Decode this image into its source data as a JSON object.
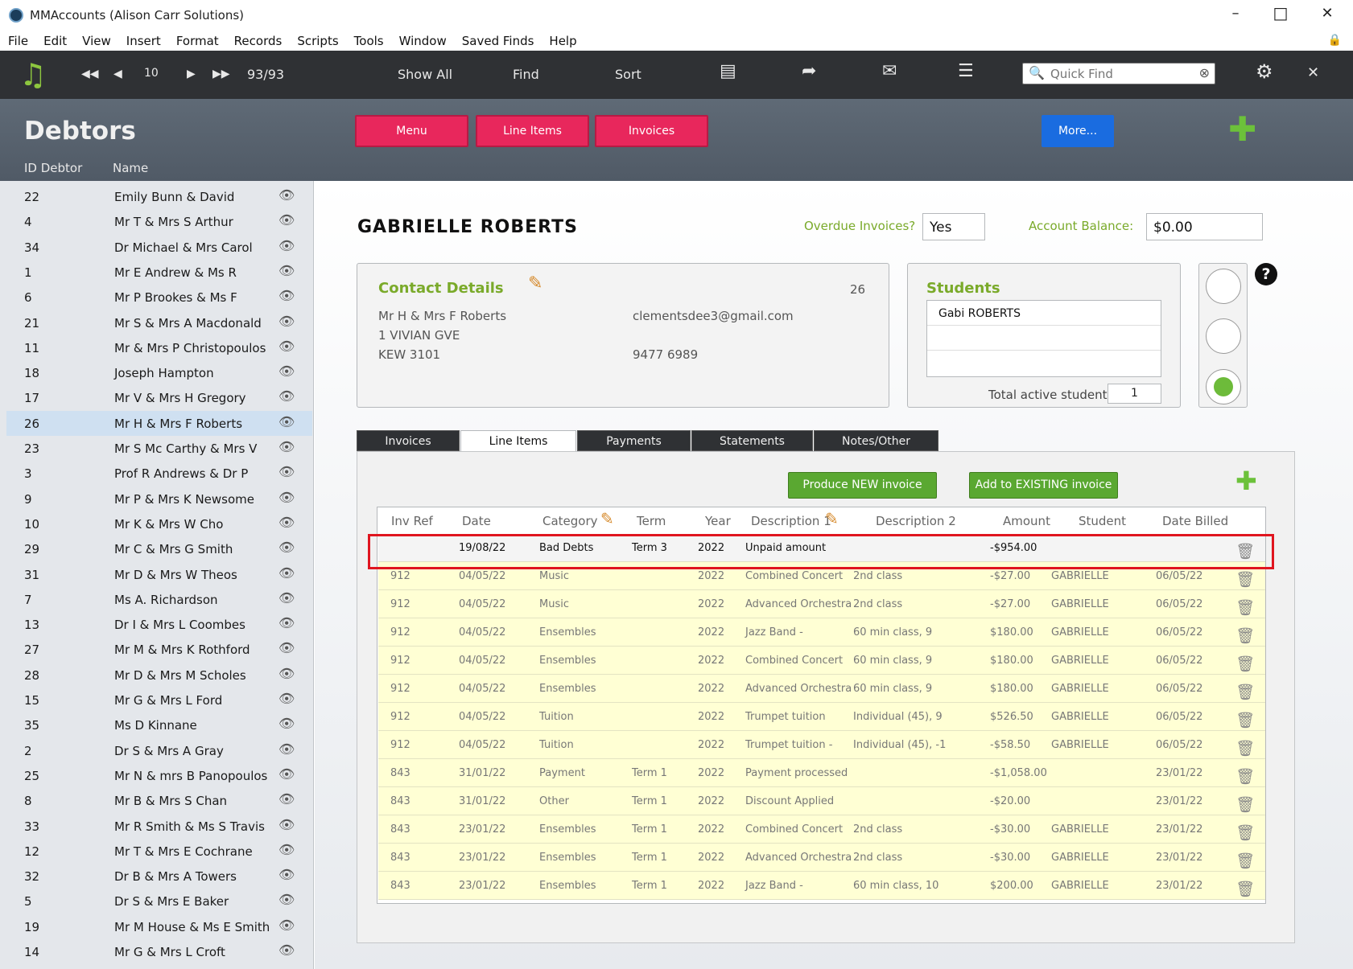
{
  "window": {
    "title": "MMAccounts (Alison Carr Solutions)"
  },
  "menu": [
    "File",
    "Edit",
    "View",
    "Insert",
    "Format",
    "Records",
    "Scripts",
    "Tools",
    "Window",
    "Saved Finds",
    "Help"
  ],
  "toolbar": {
    "record_num": "10",
    "record_count": "93/93",
    "show_all": "Show All",
    "find": "Find",
    "sort": "Sort",
    "quick_find_placeholder": "Quick Find"
  },
  "header": {
    "title": "Debtors",
    "col_id": "ID Debtor",
    "col_name": "Name",
    "menu_btn": "Menu",
    "line_items_btn": "Line Items",
    "invoices_btn": "Invoices",
    "more_btn": "More..."
  },
  "debtors": [
    {
      "id": "22",
      "name": "Emily Bunn & David"
    },
    {
      "id": "4",
      "name": "Mr T & Mrs S Arthur"
    },
    {
      "id": "34",
      "name": "Dr Michael & Mrs Carol"
    },
    {
      "id": "1",
      "name": "Mr E Andrew & Ms R"
    },
    {
      "id": "6",
      "name": "Mr P Brookes & Ms F"
    },
    {
      "id": "21",
      "name": "Mr S & Mrs A Macdonald"
    },
    {
      "id": "11",
      "name": "Mr & Mrs P Christopoulos"
    },
    {
      "id": "18",
      "name": "Joseph Hampton"
    },
    {
      "id": "17",
      "name": "Mr V & Mrs H Gregory"
    },
    {
      "id": "26",
      "name": "Mr H & Mrs F Roberts"
    },
    {
      "id": "23",
      "name": "Mr S Mc Carthy & Mrs V"
    },
    {
      "id": "3",
      "name": "Prof R Andrews & Dr P"
    },
    {
      "id": "9",
      "name": "Mr P & Mrs K Newsome"
    },
    {
      "id": "10",
      "name": "Mr K & Mrs W Cho"
    },
    {
      "id": "29",
      "name": "Mr C & Mrs G Smith"
    },
    {
      "id": "31",
      "name": "Mr D & Mrs W Theos"
    },
    {
      "id": "7",
      "name": "Ms A. Richardson"
    },
    {
      "id": "13",
      "name": "Dr I & Mrs L Coombes"
    },
    {
      "id": "27",
      "name": "Mr M & Mrs K Rothford"
    },
    {
      "id": "28",
      "name": "Mr D & Mrs M Scholes"
    },
    {
      "id": "15",
      "name": "Mr G & Mrs L Ford"
    },
    {
      "id": "35",
      "name": "Ms D Kinnane"
    },
    {
      "id": "2",
      "name": "Dr S & Mrs A Gray"
    },
    {
      "id": "25",
      "name": "Mr N & mrs B Panopoulos"
    },
    {
      "id": "8",
      "name": "Mr B & Mrs S Chan"
    },
    {
      "id": "33",
      "name": "Mr R Smith & Ms S Travis"
    },
    {
      "id": "12",
      "name": "Mr T & Mrs E Cochrane"
    },
    {
      "id": "32",
      "name": "Dr B & Mrs A Towers"
    },
    {
      "id": "5",
      "name": "Dr S & Mrs E Baker"
    },
    {
      "id": "19",
      "name": "Mr M House & Ms E Smith"
    },
    {
      "id": "14",
      "name": "Mr G & Mrs L Croft"
    }
  ],
  "selected_debtor_id": "26",
  "record": {
    "name": "GABRIELLE ROBERTS",
    "overdue_label": "Overdue Invoices?",
    "overdue_value": "Yes",
    "balance_label": "Account Balance:",
    "balance_value": "$0.00",
    "contact_title": "Contact Details",
    "contact_id": "26",
    "contact_name": "Mr H & Mrs F Roberts",
    "address1": "1 VIVIAN GVE",
    "address2": "KEW  3101",
    "email": "clementsdee3@gmail.com",
    "phone": "9477 6989",
    "students_title": "Students",
    "students": [
      "Gabi ROBERTS",
      "",
      ""
    ],
    "total_active_label": "Total active students",
    "total_active_value": "1"
  },
  "tabs": [
    "Invoices",
    "Line Items",
    "Payments",
    "Statements",
    "Notes/Other"
  ],
  "active_tab": "Line Items",
  "buttons": {
    "produce_new": "Produce NEW invoice",
    "add_existing": "Add to EXISTING invoice"
  },
  "columns": [
    "Inv Ref",
    "Date",
    "Category",
    "Term",
    "Year",
    "Description 1",
    "Description 2",
    "Amount",
    "Student",
    "Date Billed"
  ],
  "line_items": [
    [
      "",
      "19/08/22",
      "Bad Debts",
      "Term 3",
      "2022",
      "Unpaid amount",
      "",
      "-$954.00",
      "",
      ""
    ],
    [
      "912",
      "04/05/22",
      "Music",
      "",
      "2022",
      "Combined Concert",
      "2nd class",
      "-$27.00",
      "GABRIELLE",
      "06/05/22"
    ],
    [
      "912",
      "04/05/22",
      "Music",
      "",
      "2022",
      "Advanced Orchestra",
      "2nd class",
      "-$27.00",
      "GABRIELLE",
      "06/05/22"
    ],
    [
      "912",
      "04/05/22",
      "Ensembles",
      "",
      "2022",
      "Jazz Band -",
      "60 min class, 9",
      "$180.00",
      "GABRIELLE",
      "06/05/22"
    ],
    [
      "912",
      "04/05/22",
      "Ensembles",
      "",
      "2022",
      "Combined Concert",
      "60 min class, 9",
      "$180.00",
      "GABRIELLE",
      "06/05/22"
    ],
    [
      "912",
      "04/05/22",
      "Ensembles",
      "",
      "2022",
      "Advanced Orchestra",
      "60 min class, 9",
      "$180.00",
      "GABRIELLE",
      "06/05/22"
    ],
    [
      "912",
      "04/05/22",
      "Tuition",
      "",
      "2022",
      "Trumpet tuition",
      "Individual (45), 9",
      "$526.50",
      "GABRIELLE",
      "06/05/22"
    ],
    [
      "912",
      "04/05/22",
      "Tuition",
      "",
      "2022",
      "Trumpet tuition -",
      "Individual (45), -1",
      "-$58.50",
      "GABRIELLE",
      "06/05/22"
    ],
    [
      "843",
      "31/01/22",
      "Payment",
      "Term 1",
      "2022",
      "Payment processed",
      "",
      "-$1,058.00",
      "",
      "23/01/22"
    ],
    [
      "843",
      "31/01/22",
      "Other",
      "Term 1",
      "2022",
      "Discount Applied",
      "",
      "-$20.00",
      "",
      "23/01/22"
    ],
    [
      "843",
      "23/01/22",
      "Ensembles",
      "Term 1",
      "2022",
      "Combined Concert",
      "2nd class",
      "-$30.00",
      "GABRIELLE",
      "23/01/22"
    ],
    [
      "843",
      "23/01/22",
      "Ensembles",
      "Term 1",
      "2022",
      "Advanced Orchestra",
      "2nd class",
      "-$30.00",
      "GABRIELLE",
      "23/01/22"
    ],
    [
      "843",
      "23/01/22",
      "Ensembles",
      "Term 1",
      "2022",
      "Jazz Band -",
      "60 min class, 10",
      "$200.00",
      "GABRIELLE",
      "23/01/22"
    ]
  ],
  "colors": {
    "accent_green": "#7aaa2a",
    "pink": "#e8275c",
    "blue": "#1a6ce0",
    "selection_red": "#e0151f"
  }
}
